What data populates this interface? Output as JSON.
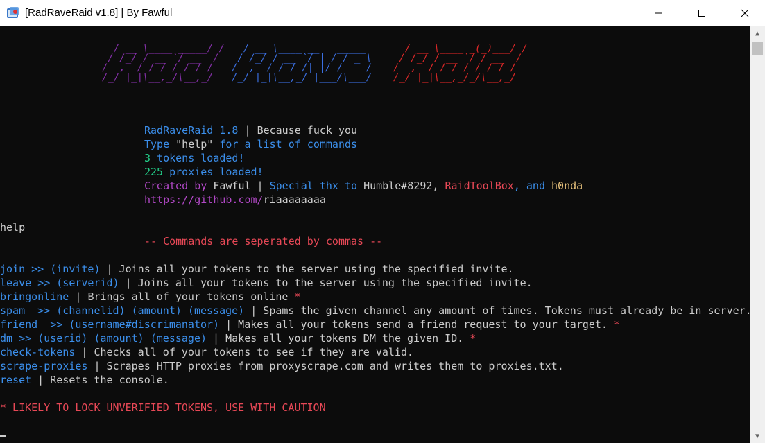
{
  "window": {
    "title": "[RadRaveRaid v1.8] | By Fawful",
    "minimize_icon": "minimize-icon",
    "maximize_icon": "maximize-icon",
    "close_icon": "close-icon"
  },
  "banner": {
    "ascii_rad": "   ____            __ \n  / __ \\____ _____/ / \n / /_/ / __ `/ __  /  \n/ _, _/ /_/ / /_/ /   \n/_/ |_|\\__,_/\\__,_/    ",
    "ascii_rave": "   ____                   \n  / __ \\____ __   _____  \n / /_/ / __ `/ | / / _ \\ \n/ _, _/ /_/ /| |/ /  __/ \n/_/ |_|\\__,_/ |___/\\___/  ",
    "ascii_raid": "   ____        _     __\n  / __ \\____ _(_)___/ /\n / /_/ / __ `/ / __  / \n/ _, _/ /_/ / / /_/ /  \n/_/ |_|\\__,_/_/\\__,_/   ",
    "colors": {
      "rad": "#8430a8",
      "rave": "#3b6fe0",
      "raid": "#dc2828"
    }
  },
  "info": {
    "version_name": "RadRaveRaid 1.8",
    "sep1": " | ",
    "tagline": "Because fuck you",
    "type_word": "Type ",
    "help_quoted": "\"help\"",
    "for_commands": " for a list of commands",
    "tokens_count": "3",
    "tokens_text": " tokens loaded!",
    "proxies_count": "225",
    "proxies_text": " proxies loaded!",
    "created_by": "Created by ",
    "author": "Fawful",
    "sep2": " | ",
    "special_thx": "Special thx to ",
    "thx1": "Humble#8292",
    "comma1": ", ",
    "thx2": "RaidToolBox",
    "and_word": ", and ",
    "thx3": "h0nda",
    "github_prefix": "https://github.com/",
    "github_user": "riaaaaaaaa"
  },
  "input_line": "help",
  "help_header": "-- Commands are seperated by commas --",
  "commands": [
    {
      "name": "join >> (invite)",
      "sep": " | ",
      "desc": "Joins all your tokens to the server using the specified invite.",
      "star": ""
    },
    {
      "name": "leave >> (serverid)",
      "sep": " | ",
      "desc": "Joins all your tokens to the server using the specified invite.",
      "star": ""
    },
    {
      "name": "bringonline",
      "sep": " | ",
      "desc": "Brings all of your tokens online",
      "star": " *"
    },
    {
      "name": "spam  >> (channelid) (amount) (message)",
      "sep": " | ",
      "desc": "Spams the given channel any amount of times. Tokens must already be in server.",
      "star": ""
    },
    {
      "name": "friend  >> (username#discrimanator)",
      "sep": " | ",
      "desc": "Makes all your tokens send a friend request to your target.",
      "star": " *"
    },
    {
      "name": "dm >> (userid) (amount) (message)",
      "sep": " | ",
      "desc": "Makes all your tokens DM the given ID.",
      "star": " *"
    },
    {
      "name": "check-tokens",
      "sep": " | ",
      "desc": "Checks all of your tokens to see if they are valid.",
      "star": ""
    },
    {
      "name": "scrape-proxies",
      "sep": " | ",
      "desc": "Scrapes HTTP proxies from proxyscrape.com and writes them to proxies.txt.",
      "star": ""
    },
    {
      "name": "reset",
      "sep": " | ",
      "desc": "Resets the console.",
      "star": ""
    }
  ],
  "warning": "* LIKELY TO LOCK UNVERIFIED TOKENS, USE WITH CAUTION"
}
